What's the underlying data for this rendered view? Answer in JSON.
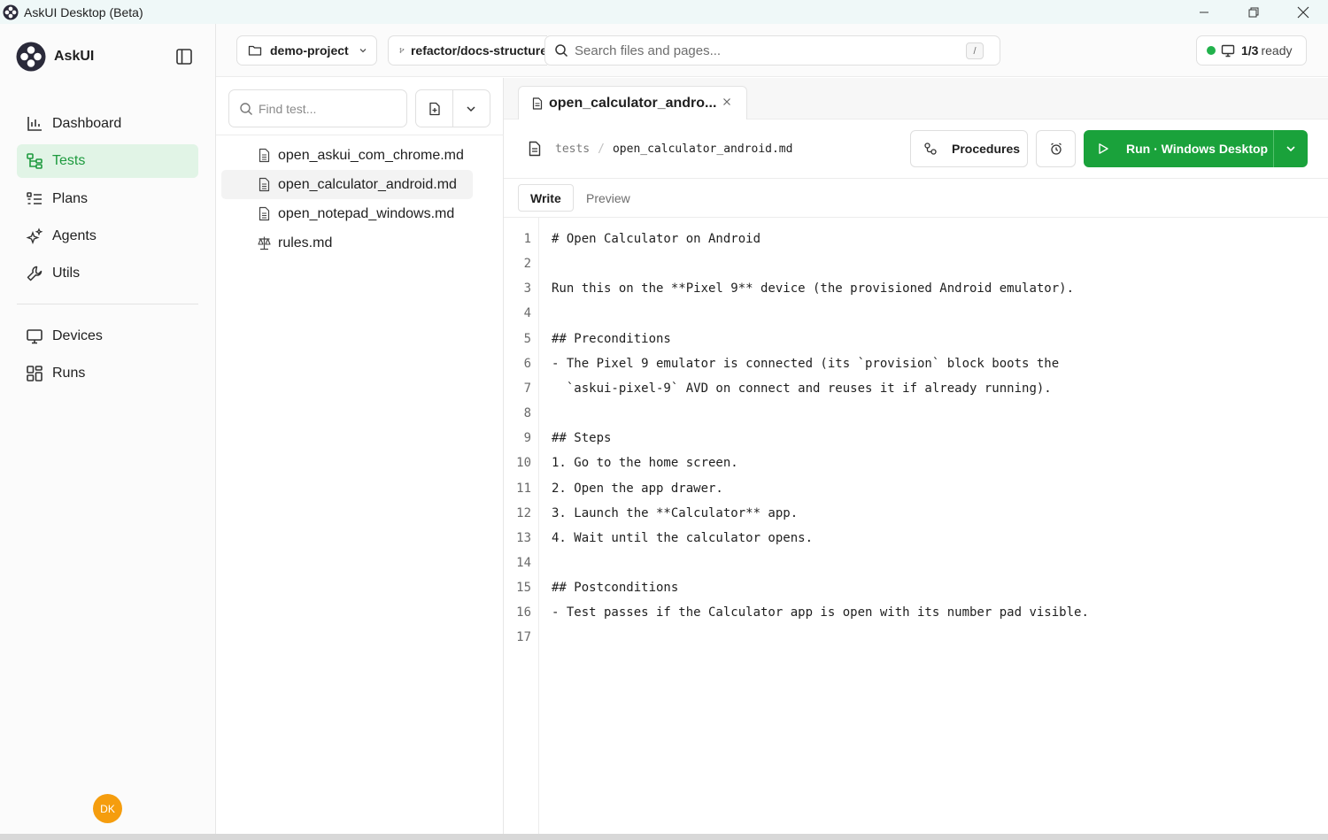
{
  "window": {
    "title": "AskUI Desktop (Beta)",
    "controls": [
      "minimize-icon",
      "restore-icon",
      "close-icon"
    ]
  },
  "sidebar": {
    "brand": "AskUI",
    "items": [
      {
        "label": "Dashboard",
        "icon": "bar-chart-icon",
        "active": false
      },
      {
        "label": "Tests",
        "icon": "tree-icon",
        "active": true
      },
      {
        "label": "Plans",
        "icon": "list-icon",
        "active": false
      },
      {
        "label": "Agents",
        "icon": "sparkles-icon",
        "active": false
      },
      {
        "label": "Utils",
        "icon": "wrench-icon",
        "active": false
      }
    ],
    "items2": [
      {
        "label": "Devices",
        "icon": "monitor-icon"
      },
      {
        "label": "Runs",
        "icon": "grid-icon"
      }
    ],
    "avatar": "DK"
  },
  "topbar": {
    "project": "demo-project",
    "branch": "refactor/docs-structure",
    "search_placeholder": "Search files and pages...",
    "search_shortcut": "/",
    "status_count": "1/3",
    "status_text": "ready"
  },
  "files": {
    "find_placeholder": "Find test...",
    "items": [
      {
        "name": "open_askui_com_chrome.md",
        "icon": "file-icon",
        "active": false
      },
      {
        "name": "open_calculator_android.md",
        "icon": "file-icon",
        "active": true
      },
      {
        "name": "open_notepad_windows.md",
        "icon": "file-icon",
        "active": false
      },
      {
        "name": "rules.md",
        "icon": "scale-icon",
        "active": false
      }
    ]
  },
  "editor": {
    "tab_title": "open_calculator_andro...",
    "breadcrumb": [
      "tests",
      "open_calculator_android.md"
    ],
    "procedures_label": "Procedures",
    "run_label": "Run · Windows Desktop",
    "modes": [
      "Write",
      "Preview"
    ],
    "lines": [
      "# Open Calculator on Android",
      "",
      "Run this on the **Pixel 9** device (the provisioned Android emulator).",
      "",
      "## Preconditions",
      "- The Pixel 9 emulator is connected (its `provision` block boots the",
      "  `askui-pixel-9` AVD on connect and reuses it if already running).",
      "",
      "## Steps",
      "1. Go to the home screen.",
      "2. Open the app drawer.",
      "3. Launch the **Calculator** app.",
      "4. Wait until the calculator opens.",
      "",
      "## Postconditions",
      "- Test passes if the Calculator app is open with its number pad visible.",
      ""
    ]
  },
  "colors": {
    "accent": "#1aa23b",
    "active_nav_bg": "#e1f4e6",
    "status_dot": "#22b24c",
    "avatar": "#f59d0e"
  }
}
